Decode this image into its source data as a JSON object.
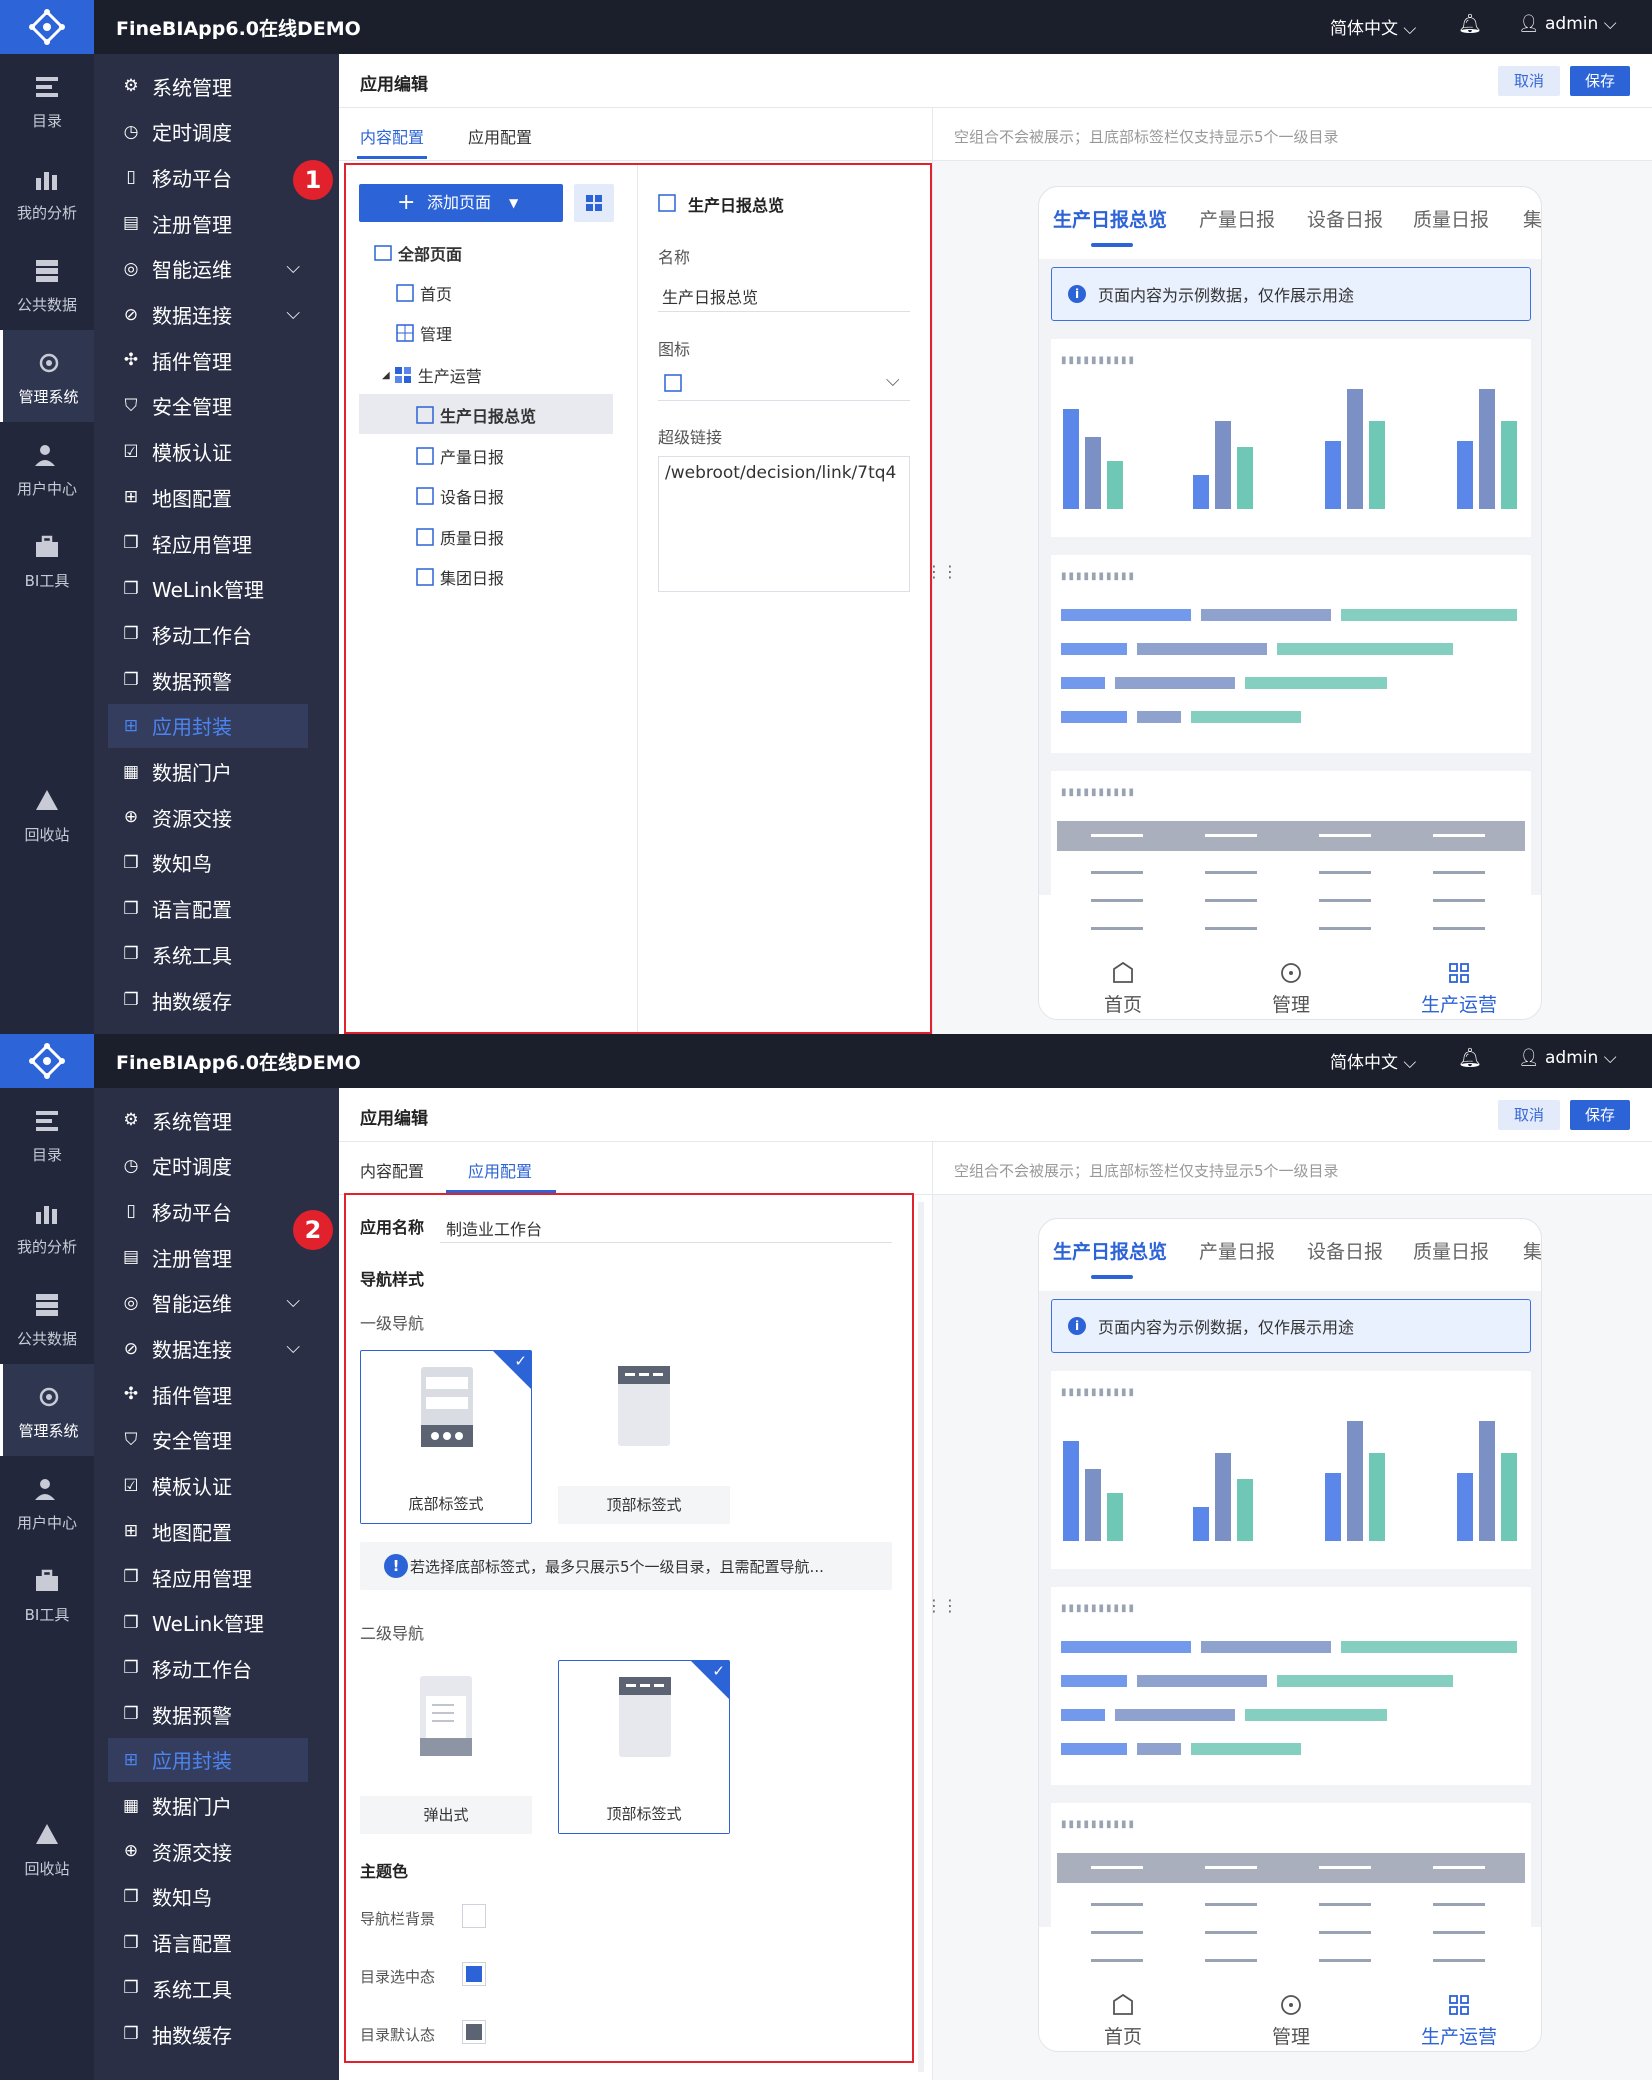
{
  "topbar": {
    "app_title": "FineBIApp6.0在线DEMO",
    "language": "简体中文",
    "user": "admin"
  },
  "rail": [
    {
      "label": "目录",
      "icon": "catalog-icon"
    },
    {
      "label": "我的分析",
      "icon": "analysis-icon"
    },
    {
      "label": "公共数据",
      "icon": "database-icon"
    },
    {
      "label": "管理系统",
      "icon": "gear-icon"
    },
    {
      "label": "用户中心",
      "icon": "user-center-icon"
    },
    {
      "label": "BI工具",
      "icon": "toolbox-icon"
    },
    {
      "label": "回收站",
      "icon": "recycle-icon"
    }
  ],
  "menu": [
    {
      "label": "系统管理",
      "icon": "⚙"
    },
    {
      "label": "定时调度",
      "icon": "◷"
    },
    {
      "label": "移动平台",
      "icon": "▯"
    },
    {
      "label": "注册管理",
      "icon": "▤"
    },
    {
      "label": "智能运维",
      "icon": "◎"
    },
    {
      "label": "数据连接",
      "icon": "⊘"
    },
    {
      "label": "插件管理",
      "icon": "✣"
    },
    {
      "label": "安全管理",
      "icon": "⛉"
    },
    {
      "label": "模板认证",
      "icon": "☑"
    },
    {
      "label": "地图配置",
      "icon": "⊞"
    },
    {
      "label": "轻应用管理",
      "icon": "❐"
    },
    {
      "label": "WeLink管理",
      "icon": "❐"
    },
    {
      "label": "移动工作台",
      "icon": "❐"
    },
    {
      "label": "数据预警",
      "icon": "❐"
    },
    {
      "label": "应用封装",
      "icon": "⊞"
    },
    {
      "label": "数据门户",
      "icon": "▦"
    },
    {
      "label": "资源交接",
      "icon": "⊕"
    },
    {
      "label": "数知鸟",
      "icon": "❐"
    },
    {
      "label": "语言配置",
      "icon": "❐"
    },
    {
      "label": "系统工具",
      "icon": "❐"
    },
    {
      "label": "抽数缓存",
      "icon": "❐"
    }
  ],
  "header": {
    "title": "应用编辑",
    "cancel": "取消",
    "save": "保存",
    "tab_content": "内容配置",
    "tab_app": "应用配置",
    "notice": "空组合不会被展示；且底部标签栏仅支持显示5个一级目录"
  },
  "badges": {
    "one": "1",
    "two": "2"
  },
  "content": {
    "add_page": "添加页面",
    "tree": {
      "root": "全部页面",
      "home": "首页",
      "manage": "管理",
      "group": "生产运营",
      "children": [
        "生产日报总览",
        "产量日报",
        "设备日报",
        "质量日报",
        "集团日报"
      ]
    },
    "form": {
      "heading": "生产日报总览",
      "name_label": "名称",
      "name_value": "生产日报总览",
      "icon_label": "图标",
      "link_label": "超级链接",
      "link_value": "/webroot/decision/link/7tq4"
    }
  },
  "appconfig": {
    "name_label": "应用名称",
    "name_value": "制造业工作台",
    "nav_style": "导航样式",
    "level1": "一级导航",
    "opt_bottom": "底部标签式",
    "opt_top": "顶部标签式",
    "warning": "若选择底部标签式，最多只展示5个一级目录，且需配置导航...",
    "level2": "二级导航",
    "opt_popup": "弹出式",
    "opt_top2": "顶部标签式",
    "theme": "主题色",
    "nav_bg": "导航栏背景",
    "sel_state": "目录选中态",
    "default_state": "目录默认态",
    "colors": {
      "nav_bg": "#ffffff",
      "selected": "#2c63d6",
      "default": "#5c6473"
    }
  },
  "phone": {
    "tabs": [
      "生产日报总览",
      "产量日报",
      "设备日报",
      "质量日报",
      "集"
    ],
    "info": "页面内容为示例数据，仅作展示用途",
    "footer": [
      "首页",
      "管理",
      "生产运营"
    ]
  },
  "colors": {
    "accent": "#2c63d6",
    "bar1": "#5b87ea",
    "bar2": "#7b90c4",
    "bar3": "#6fc7b5",
    "red": "#e1222d"
  }
}
